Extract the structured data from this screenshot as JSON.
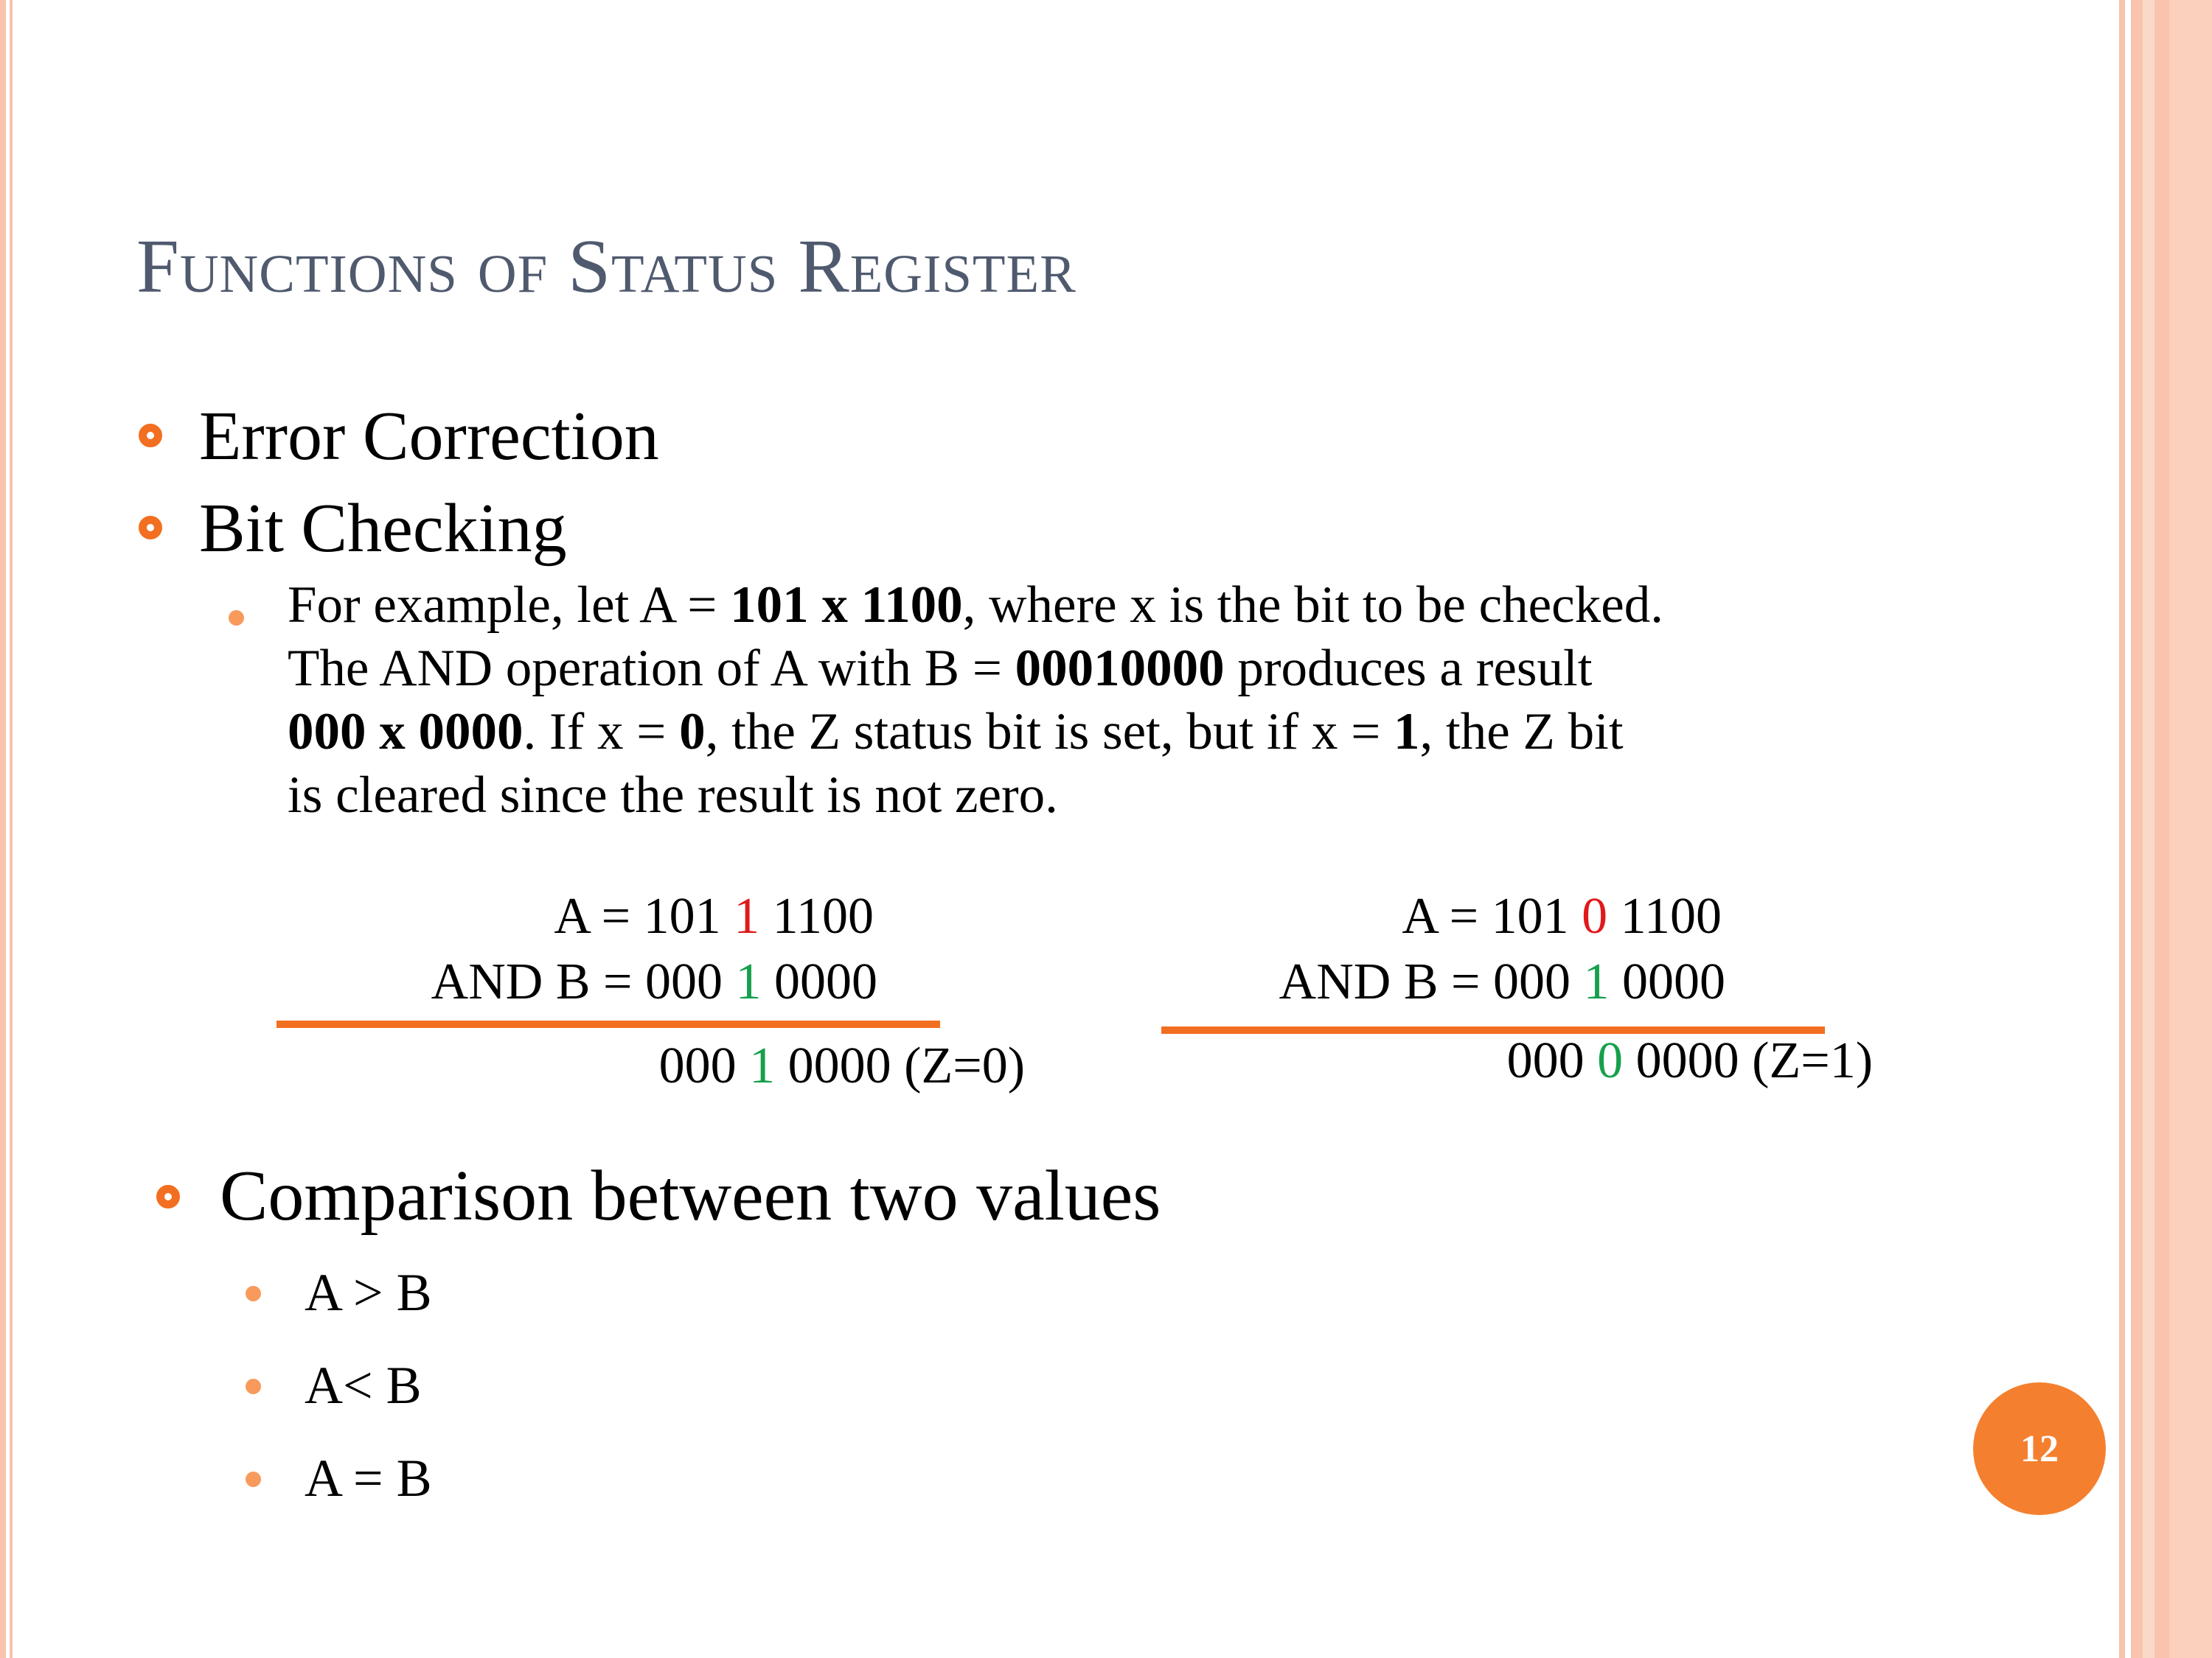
{
  "slide": {
    "title": "Functions of Status Register",
    "page_number": "12",
    "accent_color": "#f26f21",
    "title_color": "#4f5a6e"
  },
  "bullets": {
    "error_correction": "Error Correction",
    "bit_checking": "Bit Checking",
    "comparison": "Comparison between two values"
  },
  "example": {
    "l1_a": "For example, let A = ",
    "l1_b": "101 x 1100",
    "l1_c": ", where x is the bit to be checked.",
    "l2_a": "The AND operation of A with B = ",
    "l2_b": "00010000",
    "l2_c": " produces a result",
    "l3_a": "000 x 0000",
    "l3_b": ". If x = ",
    "l3_c": "0",
    "l3_d": ", the Z status bit is set, but if x = ",
    "l3_e": "1",
    "l3_f": ", the Z bit",
    "l4": "is cleared since the result is not zero."
  },
  "calc_left": {
    "a_pre": "A = 101 ",
    "a_bit": "1",
    "a_post": " 1100",
    "b_pre": "AND B = 000 ",
    "b_bit": "1",
    "b_post": " 0000",
    "r_pre": "000 ",
    "r_bit": "1",
    "r_post": " 0000 (Z=0)"
  },
  "calc_right": {
    "a_pre": "A = 101 ",
    "a_bit": "0",
    "a_post": " 1100",
    "b_pre": "AND B = 000 ",
    "b_bit": "1",
    "b_post": " 0000",
    "r_pre": "000 ",
    "r_bit": "0",
    "r_post": " 0000 (Z=1)"
  },
  "comparisons": [
    "A > B",
    "A< B",
    "A = B"
  ]
}
